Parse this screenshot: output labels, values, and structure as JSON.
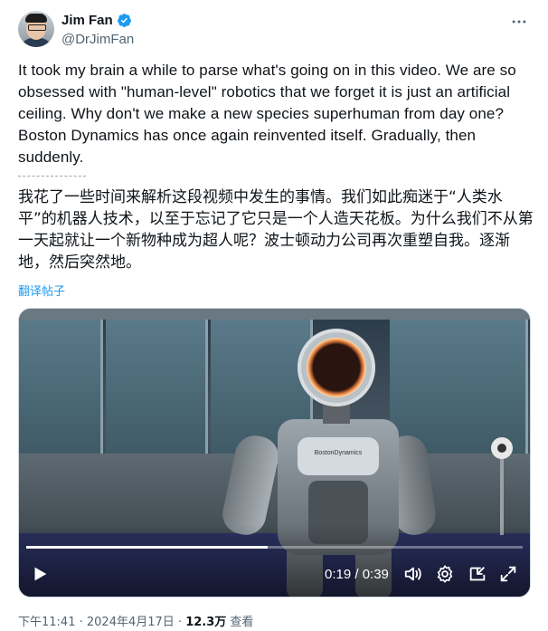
{
  "author": {
    "name": "Jim Fan",
    "handle": "@DrJimFan"
  },
  "tweet": {
    "text": "It took my brain a while to parse what's going on in this video. We are so obsessed with \"human-level\" robotics that we forget it is just an artificial ceiling. Why don't we make a new species superhuman from day one? Boston Dynamics has once again reinvented itself. Gradually, then suddenly.",
    "translated_text": "我花了一些时间来解析这段视频中发生的事情。我们如此痴迷于“人类水平”的机器人技术，以至于忘记了它只是一个人造天花板。为什么我们不从第一天起就让一个新物种成为超人呢？波士顿动力公司再次重塑自我。逐渐地，然后突然地。",
    "translate_link": "翻译帖子"
  },
  "video": {
    "time_display": "0:19 / 0:39",
    "progress": 0.487,
    "robot_chest_label": "BostonDynamics"
  },
  "meta": {
    "time": "下午11:41",
    "separator1": " · ",
    "date": "2024年4月17日",
    "separator2": " · ",
    "views": "12.3万",
    "views_label": " 查看"
  },
  "colors": {
    "accent": "#1d9bf0",
    "secondary_text": "#536471"
  }
}
